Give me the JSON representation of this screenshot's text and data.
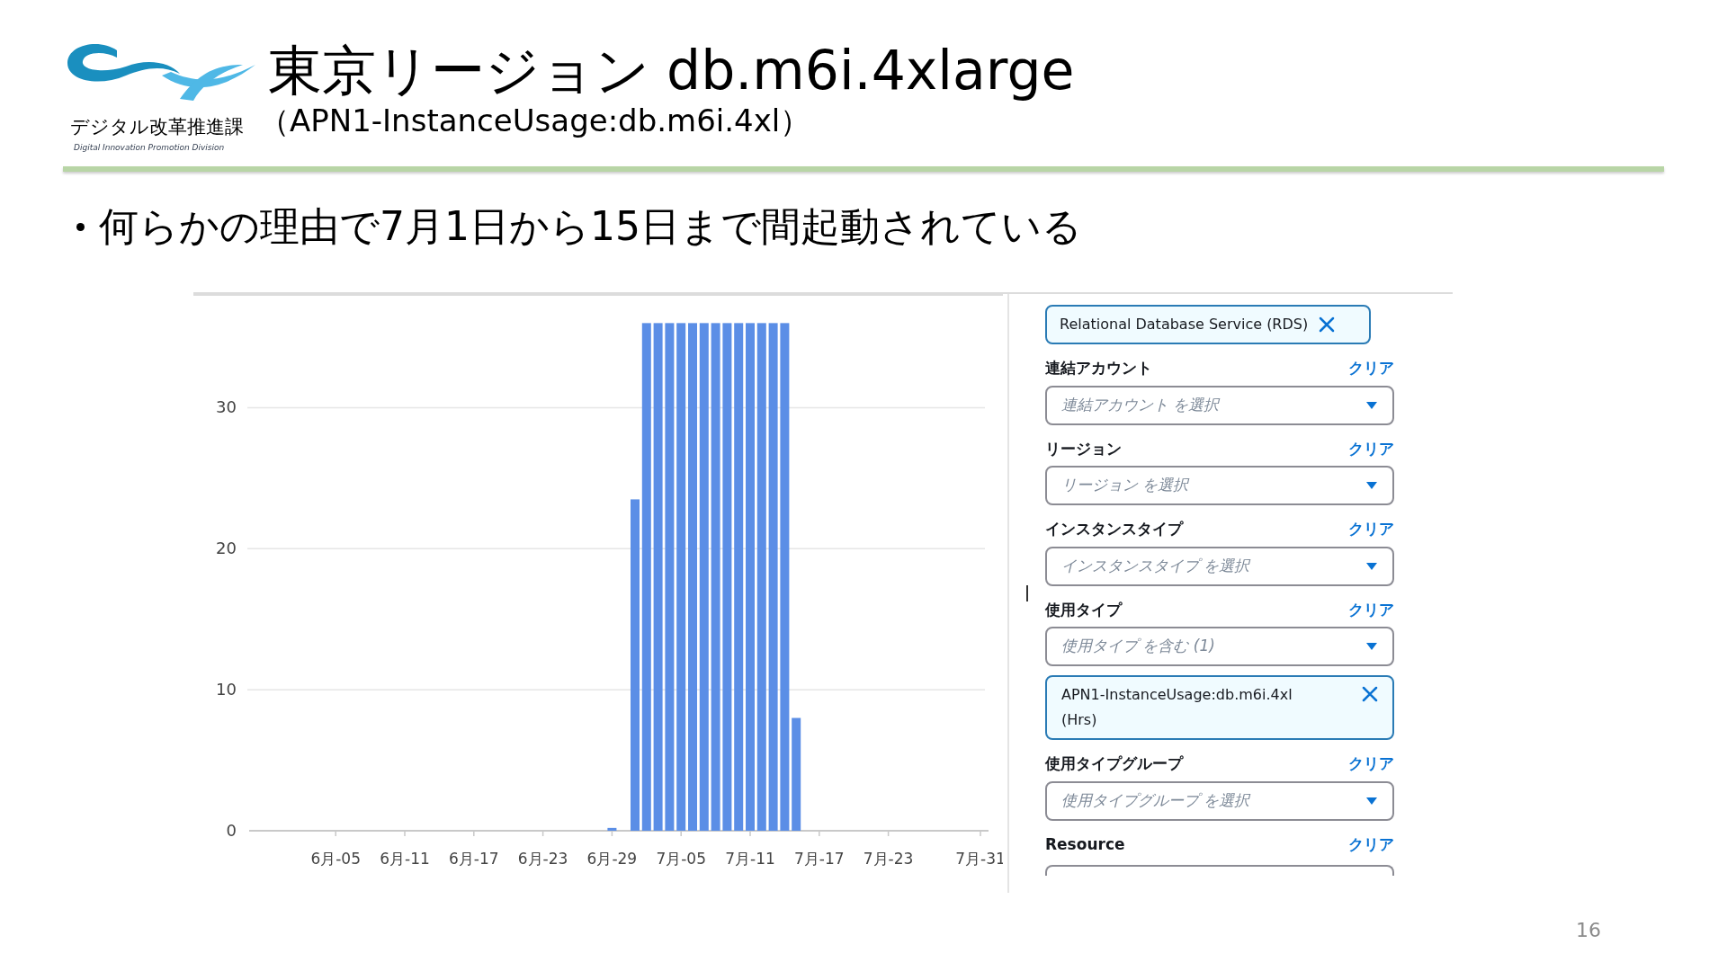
{
  "logo": {
    "org_name": "デジタル改革推進課",
    "org_name_en": "Digital Innovation Promotion Division"
  },
  "title": "東京リージョン db.m6i.4xlarge",
  "subtitle": "（APN1-InstanceUsage:db.m6i.4xl）",
  "bullets": [
    "何らかの理由で7月1日から15日まで間起動されている"
  ],
  "chart": {
    "chart_data": {
      "type": "bar",
      "categories": [
        null,
        null,
        null,
        null,
        "6月-05",
        null,
        null,
        null,
        null,
        null,
        "6月-11",
        null,
        null,
        null,
        null,
        null,
        "6月-17",
        null,
        null,
        null,
        null,
        null,
        "6月-23",
        null,
        null,
        null,
        null,
        null,
        "6月-29",
        null,
        null,
        null,
        null,
        null,
        "7月-05",
        null,
        null,
        null,
        null,
        null,
        "7月-11",
        null,
        null,
        null,
        null,
        null,
        "7月-17",
        null,
        null,
        null,
        null,
        null,
        "7月-23",
        null,
        null,
        null,
        null,
        null,
        null,
        null,
        "7月-31"
      ],
      "grid": true,
      "series": [
        {
          "color": "#5b8ee6",
          "values": [
            0,
            0,
            0,
            0,
            0,
            0,
            0,
            0,
            0,
            0,
            0,
            0,
            0,
            0,
            0,
            0,
            0,
            0,
            0,
            0,
            0,
            0,
            0,
            0,
            0,
            0,
            0,
            0,
            0.2,
            0,
            23.5,
            36,
            36,
            36,
            36,
            36,
            36,
            36,
            36,
            36,
            36,
            36,
            36,
            36,
            8,
            0,
            0,
            0,
            0,
            0,
            0,
            0,
            0,
            0,
            0,
            0,
            0,
            0,
            0,
            0,
            0
          ]
        }
      ],
      "ylim": [
        0,
        38
      ],
      "yticks": [
        0,
        10,
        20,
        30
      ]
    }
  },
  "filters": [
    {
      "kind": "chip",
      "text": "Relational Database Service (RDS)"
    },
    {
      "kind": "filter",
      "label": "連結アカウント",
      "clear": "クリア",
      "select_text": "連結アカウント を選択"
    },
    {
      "kind": "filter",
      "label": "リージョン",
      "clear": "クリア",
      "select_text": "リージョン を選択"
    },
    {
      "kind": "filter",
      "label": "インスタンスタイプ",
      "clear": "クリア",
      "select_text": "インスタンスタイプ を選択"
    },
    {
      "kind": "filter",
      "label": "使用タイプ",
      "clear": "クリア",
      "select_text": "使用タイプ を含む (1)"
    },
    {
      "kind": "token",
      "text": "APN1-InstanceUsage:db.m6i.4xl (Hrs)"
    },
    {
      "kind": "filter",
      "label": "使用タイプグループ",
      "clear": "クリア",
      "select_text": "使用タイプグループ を選択"
    },
    {
      "kind": "filter_cut",
      "label": "Resource",
      "clear": "クリア"
    }
  ],
  "page_number": "16"
}
